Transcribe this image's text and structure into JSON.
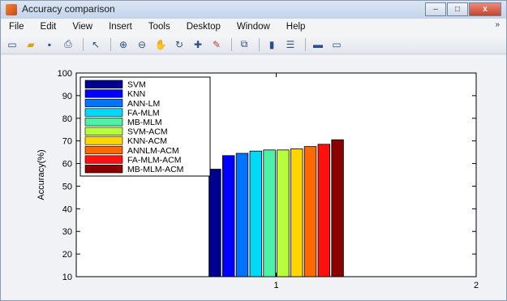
{
  "window": {
    "title": "Accuracy comparison",
    "buttons": {
      "minimize": "–",
      "maximize": "□",
      "close": "x"
    }
  },
  "menu": {
    "items": [
      "File",
      "Edit",
      "View",
      "Insert",
      "Tools",
      "Desktop",
      "Window",
      "Help"
    ],
    "overflow_arrow": "»"
  },
  "toolbar": {
    "icons": [
      "new-figure-icon",
      "open-file-icon",
      "save-icon",
      "print-icon",
      "pointer-icon",
      "zoom-in-icon",
      "zoom-out-icon",
      "pan-icon",
      "rotate-3d-icon",
      "data-cursor-icon",
      "brush-icon",
      "link-icon",
      "colorbar-icon",
      "legend-icon",
      "hide-plot-tools-icon",
      "show-plot-tools-icon"
    ]
  },
  "chart_data": {
    "type": "bar",
    "ylabel": "Accuracy(%)",
    "xlabel": "",
    "title": "",
    "ylim": [
      10,
      100
    ],
    "xlim": [
      0,
      2
    ],
    "yticks": [
      10,
      20,
      30,
      40,
      50,
      60,
      70,
      80,
      90,
      100
    ],
    "xticks": [
      1,
      2
    ],
    "grid": false,
    "legend_position": "top-left",
    "series": [
      {
        "name": "SVM",
        "value": 57.5,
        "color": "#00008f"
      },
      {
        "name": "KNN",
        "value": 63.5,
        "color": "#0000ff"
      },
      {
        "name": "ANN-LM",
        "value": 64.5,
        "color": "#0073ff"
      },
      {
        "name": "FA-MLM",
        "value": 65.5,
        "color": "#00d8f7"
      },
      {
        "name": "MB-MLM",
        "value": 66.0,
        "color": "#4df2a6"
      },
      {
        "name": "SVM-ACM",
        "value": 66.0,
        "color": "#b7ff3d"
      },
      {
        "name": "KNN-ACM",
        "value": 66.5,
        "color": "#ffd700"
      },
      {
        "name": "ANNLM-ACM",
        "value": 67.5,
        "color": "#ff6a00"
      },
      {
        "name": "FA-MLM-ACM",
        "value": 68.5,
        "color": "#ff1010"
      },
      {
        "name": "MB-MLM-ACM",
        "value": 70.5,
        "color": "#8b0000"
      }
    ]
  }
}
